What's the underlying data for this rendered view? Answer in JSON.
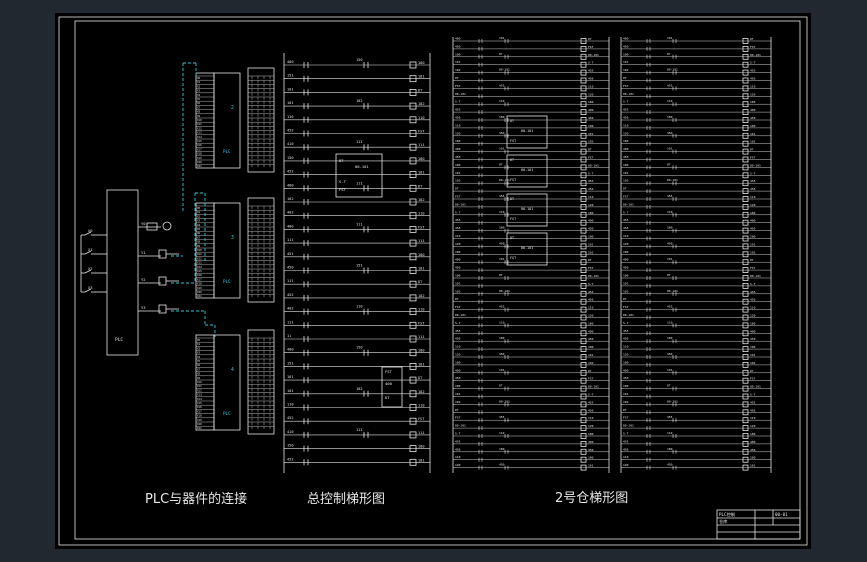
{
  "captions": {
    "plc_connection": "PLC与器件的连接",
    "master_ladder": "总控制梯形图",
    "bin2_ladder": "2号仓梯形图"
  },
  "plc_modules": [
    "2",
    "3",
    "4"
  ],
  "plc_module_tag": "PLC",
  "main_plc_label": "PLC",
  "master_rungs": [
    {
      "in": [
        "400",
        "150",
        "451"
      ],
      "coil": "180"
    },
    {
      "in": [
        "450",
        "151",
        "452"
      ],
      "coil": "181"
    },
    {
      "in": [
        "400",
        "111",
        "101"
      ],
      "coil": "DT"
    },
    {
      "in": [
        "101",
        "102",
        "452"
      ],
      "coil": "182"
    },
    {
      "in": [
        "402",
        "110",
        "403"
      ],
      "coil": "110"
    },
    {
      "in": [
        "400",
        "111",
        "452"
      ],
      "coil": "FST"
    },
    {
      "in": [
        "410",
        "111",
        "11"
      ],
      "coil": "111"
    }
  ],
  "bin2_labels": [
    "400",
    "450",
    "100",
    "101",
    "102",
    "DT",
    "FST",
    "00-101",
    "S-T",
    "455",
    "456",
    "110",
    "120",
    "180"
  ],
  "title_block": {
    "line1": "PLC控制",
    "line2": "仓库",
    "code": "00-01"
  },
  "colors": {
    "background": "#212830",
    "sheet": "#000000",
    "line": "#e6e6e6",
    "dashed_wire": "#2fc4d4",
    "plc_accent": "#2fd0e0"
  }
}
